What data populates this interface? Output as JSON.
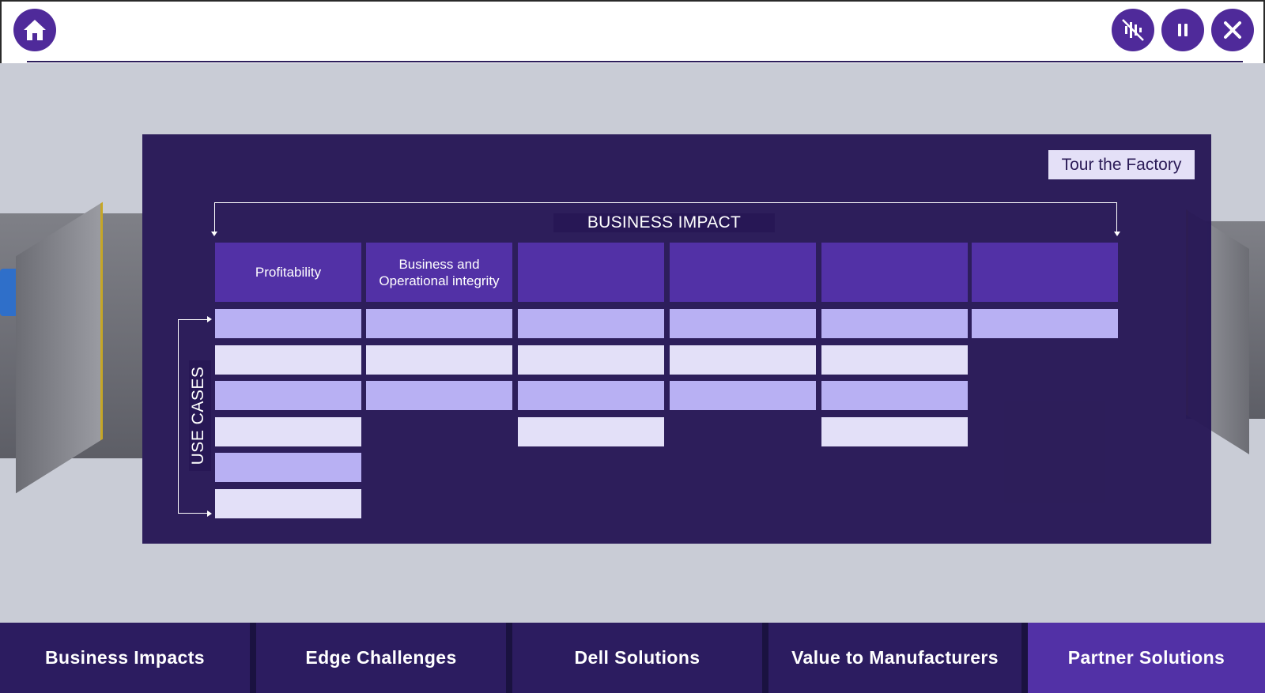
{
  "header": {
    "home_icon": "home-icon",
    "mute_icon": "audio-muted-icon",
    "pause_icon": "pause-icon",
    "close_icon": "close-icon",
    "accent": "#4f2a9a"
  },
  "panel": {
    "tour_button": "Tour the Factory",
    "business_impact_label": "BUSINESS IMPACT",
    "use_cases_label": "USE CASES",
    "columns": [
      {
        "label": "Profitability",
        "cells": [
          "dark",
          "light",
          "dark",
          "light",
          "dark",
          "light"
        ]
      },
      {
        "label": "Business and Operational integrity",
        "cells": [
          "dark",
          "light",
          "dark"
        ]
      },
      {
        "label": "",
        "cells": [
          "dark",
          "light",
          "dark",
          "light"
        ]
      },
      {
        "label": "",
        "cells": [
          "dark",
          "light",
          "dark"
        ]
      },
      {
        "label": "",
        "cells": [
          "dark",
          "light",
          "dark",
          "light"
        ]
      },
      {
        "label": "",
        "cells": [
          "dark"
        ]
      }
    ]
  },
  "nav": {
    "items": [
      {
        "label": "Business Impacts",
        "active": false
      },
      {
        "label": "Edge Challenges",
        "active": false
      },
      {
        "label": "Dell Solutions",
        "active": false
      },
      {
        "label": "Value to Manufacturers",
        "active": false
      },
      {
        "label": "Partner Solutions",
        "active": true
      }
    ]
  }
}
